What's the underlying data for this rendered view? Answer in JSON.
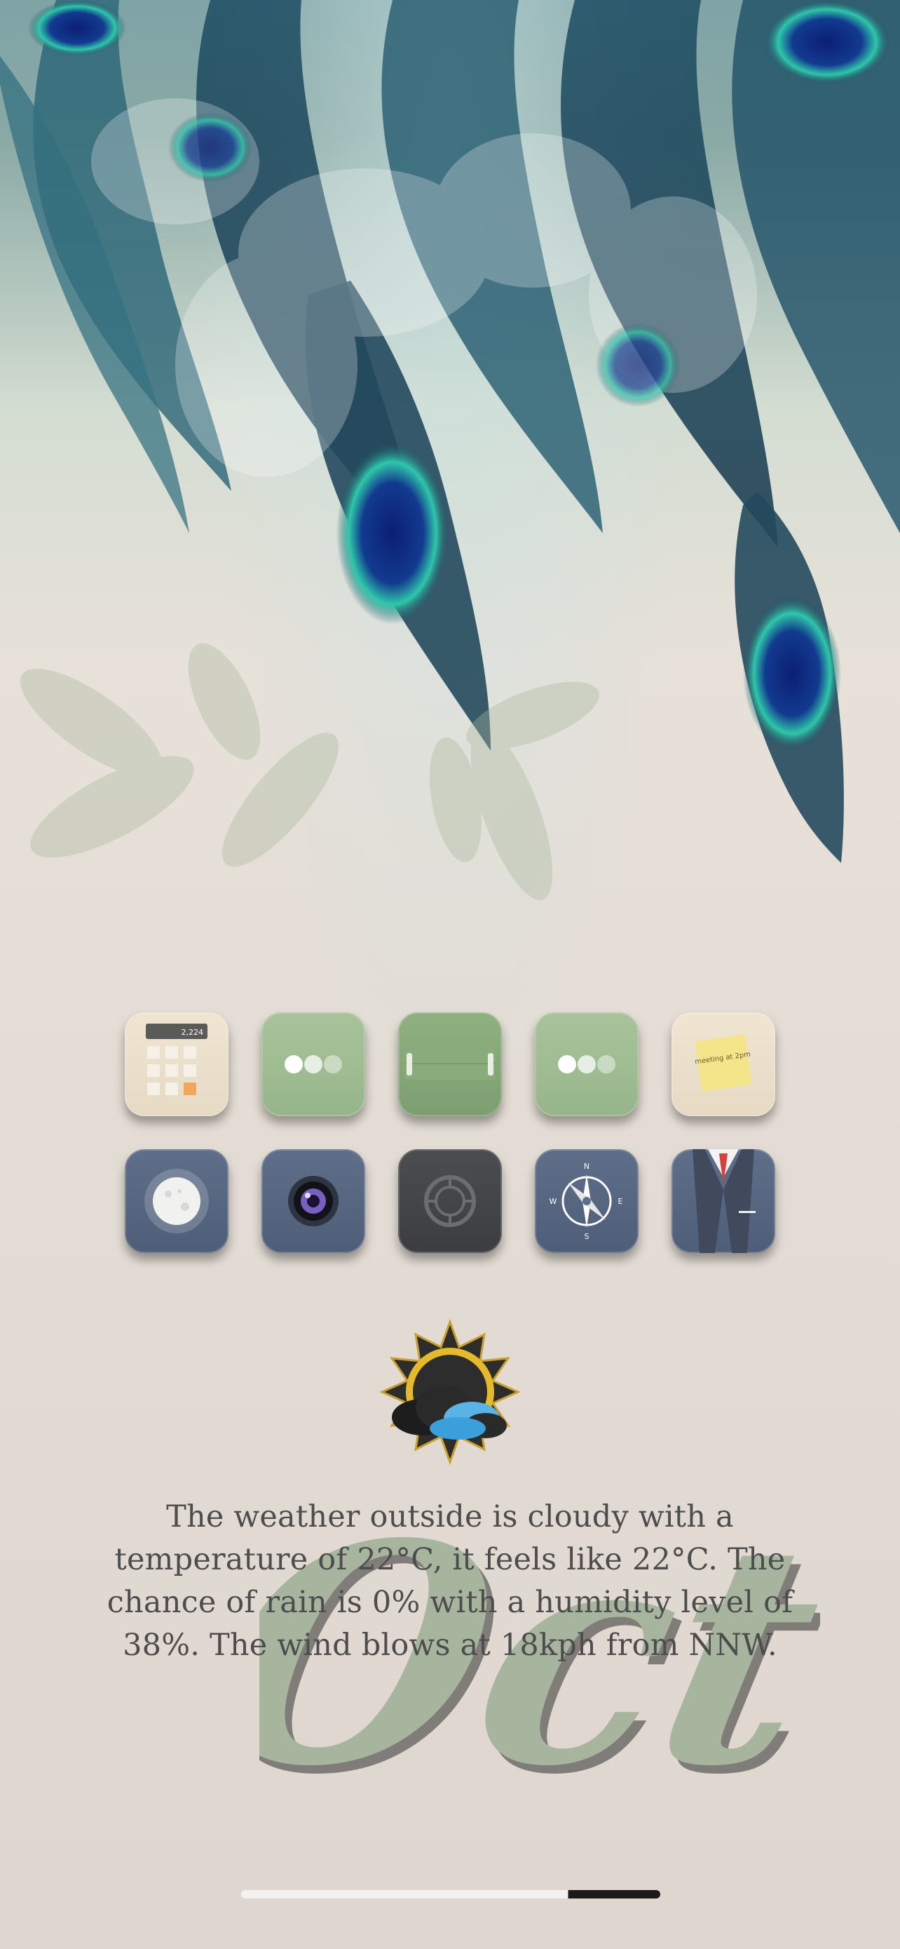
{
  "home_screen": {
    "wallpaper": "peacock-feathers-wallpaper",
    "accent_colors": {
      "sage": "#a8c39b",
      "slate": "#5f6f8a",
      "charcoal": "#444548",
      "cream": "#efe5d1"
    },
    "icons_row_1": [
      {
        "icon": "calculator-icon",
        "display_value": "2,224"
      },
      {
        "icon": "dots-icon"
      },
      {
        "icon": "clipboard-icon"
      },
      {
        "icon": "dots-icon"
      },
      {
        "icon": "sticky-note-icon",
        "note_text": "meeting at 2pm"
      }
    ],
    "icons_row_2": [
      {
        "icon": "moon-icon"
      },
      {
        "icon": "camera-icon"
      },
      {
        "icon": "settings-gear-icon"
      },
      {
        "icon": "compass-icon",
        "directions": [
          "N",
          "E",
          "S",
          "W"
        ]
      },
      {
        "icon": "suit-icon"
      }
    ],
    "weather": {
      "icon": "cloudy-sun-icon",
      "description": "The weather outside is cloudy with a temperature of 22°C, it feels like 22°C. The chance of rain is 0% with a humidity level of 38%. The wind blows at 18kph from NNW."
    },
    "month_art": "Oct"
  }
}
